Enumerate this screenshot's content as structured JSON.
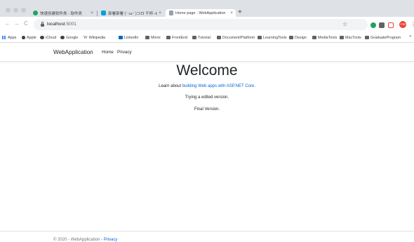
{
  "browser": {
    "tabs": [
      {
        "title": "快速创建软件类 - 软件类",
        "favicon_color": "#1da462"
      },
      {
        "title": "部署部署 (´･ω･`)つロ 干杯--bil",
        "favicon_color": "#00a1d6"
      },
      {
        "title": "Home page - WebApplication",
        "favicon_color": "#9aa0a6"
      }
    ],
    "tab_close_glyph": "×",
    "new_tab_glyph": "+",
    "nav": {
      "back": "←",
      "forward": "→",
      "reload": "C"
    },
    "address": {
      "host": "localhost",
      "port": ":5001"
    },
    "star_glyph": "☆",
    "profile_initials": "CM",
    "menu_glyph": "⋮",
    "bookmarks": [
      {
        "label": "Apps",
        "icon": "apps-grid-icon"
      },
      {
        "label": "Apple",
        "icon": "apple-logo-icon"
      },
      {
        "label": "iCloud",
        "icon": "globe-icon"
      },
      {
        "label": "Google",
        "icon": "globe-icon"
      },
      {
        "label": "Wikipedia",
        "icon": "wikipedia-icon"
      },
      {
        "label": "LinkedIn",
        "icon": "linkedin-icon"
      },
      {
        "label": "Mirror",
        "icon": "folder-icon"
      },
      {
        "label": "FrontEnd",
        "icon": "folder-icon"
      },
      {
        "label": "Tutorial",
        "icon": "folder-icon"
      },
      {
        "label": "Document/Platform",
        "icon": "folder-icon"
      },
      {
        "label": "LearningTools",
        "icon": "folder-icon"
      },
      {
        "label": "Design",
        "icon": "folder-icon"
      },
      {
        "label": "MediaTools",
        "icon": "folder-icon"
      },
      {
        "label": "MacTools",
        "icon": "folder-icon"
      },
      {
        "label": "GraduateProgram",
        "icon": "folder-icon"
      }
    ],
    "bookmarks_overflow": "»"
  },
  "site": {
    "brand": "WebApplication",
    "nav": {
      "home": "Home",
      "privacy": "Privacy"
    },
    "heading": "Welcome",
    "learn_prefix": "Learn about ",
    "learn_link": "building Web apps with ASP.NET Core",
    "learn_suffix": ".",
    "line1": "Trying a edited version.",
    "line2": "Final Version.",
    "footer_text": "© 2020 - WebApplication - ",
    "footer_link": "Privacy"
  },
  "colors": {
    "link": "#0366d6",
    "muted": "#6c757d",
    "text": "#212529"
  }
}
